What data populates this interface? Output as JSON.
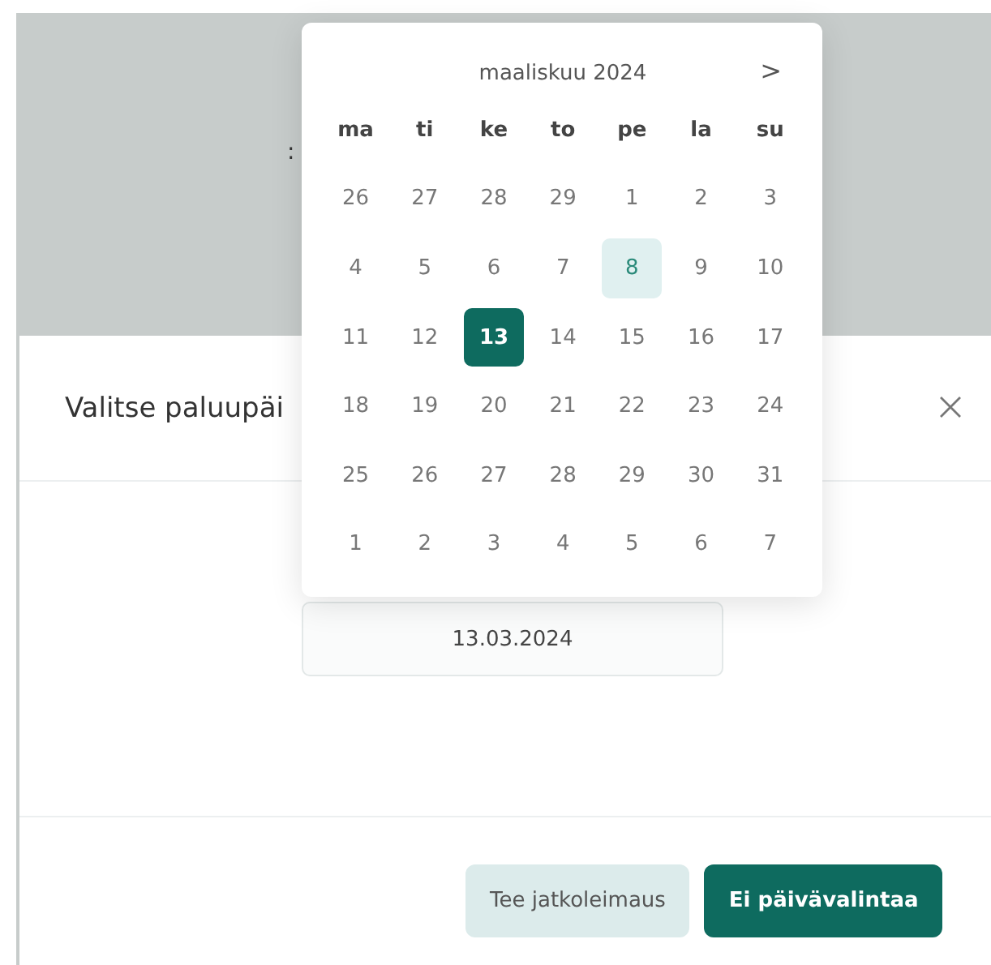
{
  "backdrop": {
    "text": ":"
  },
  "modal": {
    "title": "Valitse paluupäi",
    "date_field": {
      "value": "13.03.2024"
    },
    "buttons": [
      {
        "label": "Tee jatkoleimaus",
        "kind": "secondary"
      },
      {
        "label": "Ei päivävalintaa",
        "kind": "primary"
      }
    ]
  },
  "calendar": {
    "month": "maaliskuu 2024",
    "next": ">",
    "weekdays": [
      "ma",
      "ti",
      "ke",
      "to",
      "pe",
      "la",
      "su"
    ],
    "weeks": [
      [
        {
          "day": "26",
          "selected": false,
          "today": false
        },
        {
          "day": "27",
          "selected": false,
          "today": false
        },
        {
          "day": "28",
          "selected": false,
          "today": false
        },
        {
          "day": "29",
          "selected": false,
          "today": false
        },
        {
          "day": "1",
          "selected": false,
          "today": false
        },
        {
          "day": "2",
          "selected": false,
          "today": false
        },
        {
          "day": "3",
          "selected": false,
          "today": false
        }
      ],
      [
        {
          "day": "4",
          "selected": false,
          "today": false
        },
        {
          "day": "5",
          "selected": false,
          "today": false
        },
        {
          "day": "6",
          "selected": false,
          "today": false
        },
        {
          "day": "7",
          "selected": false,
          "today": false
        },
        {
          "day": "8",
          "selected": false,
          "today": true
        },
        {
          "day": "9",
          "selected": false,
          "today": false
        },
        {
          "day": "10",
          "selected": false,
          "today": false
        }
      ],
      [
        {
          "day": "11",
          "selected": false,
          "today": false
        },
        {
          "day": "12",
          "selected": false,
          "today": false
        },
        {
          "day": "13",
          "selected": true,
          "today": false
        },
        {
          "day": "14",
          "selected": false,
          "today": false
        },
        {
          "day": "15",
          "selected": false,
          "today": false
        },
        {
          "day": "16",
          "selected": false,
          "today": false
        },
        {
          "day": "17",
          "selected": false,
          "today": false
        }
      ],
      [
        {
          "day": "18",
          "selected": false,
          "today": false
        },
        {
          "day": "19",
          "selected": false,
          "today": false
        },
        {
          "day": "20",
          "selected": false,
          "today": false
        },
        {
          "day": "21",
          "selected": false,
          "today": false
        },
        {
          "day": "22",
          "selected": false,
          "today": false
        },
        {
          "day": "23",
          "selected": false,
          "today": false
        },
        {
          "day": "24",
          "selected": false,
          "today": false
        }
      ],
      [
        {
          "day": "25",
          "selected": false,
          "today": false
        },
        {
          "day": "26",
          "selected": false,
          "today": false
        },
        {
          "day": "27",
          "selected": false,
          "today": false
        },
        {
          "day": "28",
          "selected": false,
          "today": false
        },
        {
          "day": "29",
          "selected": false,
          "today": false
        },
        {
          "day": "30",
          "selected": false,
          "today": false
        },
        {
          "day": "31",
          "selected": false,
          "today": false
        }
      ],
      [
        {
          "day": "1",
          "selected": false,
          "today": false
        },
        {
          "day": "2",
          "selected": false,
          "today": false
        },
        {
          "day": "3",
          "selected": false,
          "today": false
        },
        {
          "day": "4",
          "selected": false,
          "today": false
        },
        {
          "day": "5",
          "selected": false,
          "today": false
        },
        {
          "day": "6",
          "selected": false,
          "today": false
        },
        {
          "day": "7",
          "selected": false,
          "today": false
        }
      ]
    ]
  }
}
